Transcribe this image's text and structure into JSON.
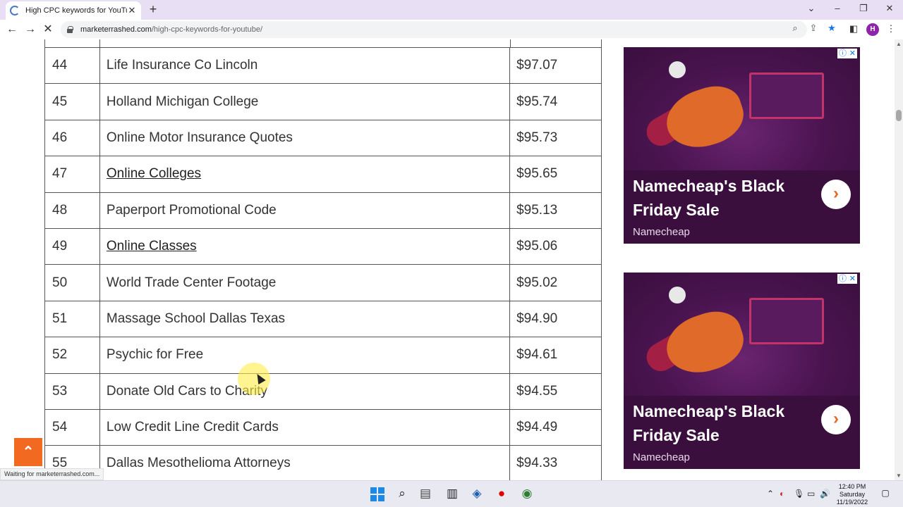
{
  "browser": {
    "tab_title": "High CPC keywords for YouTube",
    "tab_close": "✕",
    "new_tab": "+",
    "url_domain": "marketerrashed.com",
    "url_path": "/high-cpc-keywords-for-youtube/",
    "profile_initial": "H",
    "status_text": "Waiting for marketerrashed.com..."
  },
  "keywords": [
    {
      "num": "44",
      "keyword": "Life Insurance Co Lincoln",
      "cpc": "$97.07",
      "link": false
    },
    {
      "num": "45",
      "keyword": "Holland Michigan College",
      "cpc": "$95.74",
      "link": false
    },
    {
      "num": "46",
      "keyword": "Online Motor Insurance Quotes",
      "cpc": "$95.73",
      "link": false
    },
    {
      "num": "47",
      "keyword": "Online Colleges",
      "cpc": "$95.65",
      "link": true
    },
    {
      "num": "48",
      "keyword": "Paperport Promotional Code",
      "cpc": "$95.13",
      "link": false
    },
    {
      "num": "49",
      "keyword": "Online Classes",
      "cpc": "$95.06",
      "link": true
    },
    {
      "num": "50",
      "keyword": "World Trade Center Footage",
      "cpc": "$95.02",
      "link": false
    },
    {
      "num": "51",
      "keyword": "Massage School Dallas Texas",
      "cpc": "$94.90",
      "link": false
    },
    {
      "num": "52",
      "keyword": "Psychic for Free",
      "cpc": "$94.61",
      "link": false
    },
    {
      "num": "53",
      "keyword": "Donate Old Cars to Charity",
      "cpc": "$94.55",
      "link": false
    },
    {
      "num": "54",
      "keyword": "Low Credit Line Credit Cards",
      "cpc": "$94.49",
      "link": false
    },
    {
      "num": "55",
      "keyword": "Dallas Mesothelioma Attorneys",
      "cpc": "$94.33",
      "link": false
    }
  ],
  "ads": [
    {
      "headline": "Namecheap's Black Friday Sale",
      "brand": "Namecheap"
    },
    {
      "headline": "Namecheap's Black Friday Sale",
      "brand": "Namecheap"
    }
  ],
  "taskbar": {
    "time": "12:40 PM",
    "day": "Saturday",
    "date": "11/19/2022"
  },
  "colors": {
    "ad_background": "#3a0f3e",
    "back_to_top": "#f26a21",
    "tab_bar": "#e8dff5"
  }
}
